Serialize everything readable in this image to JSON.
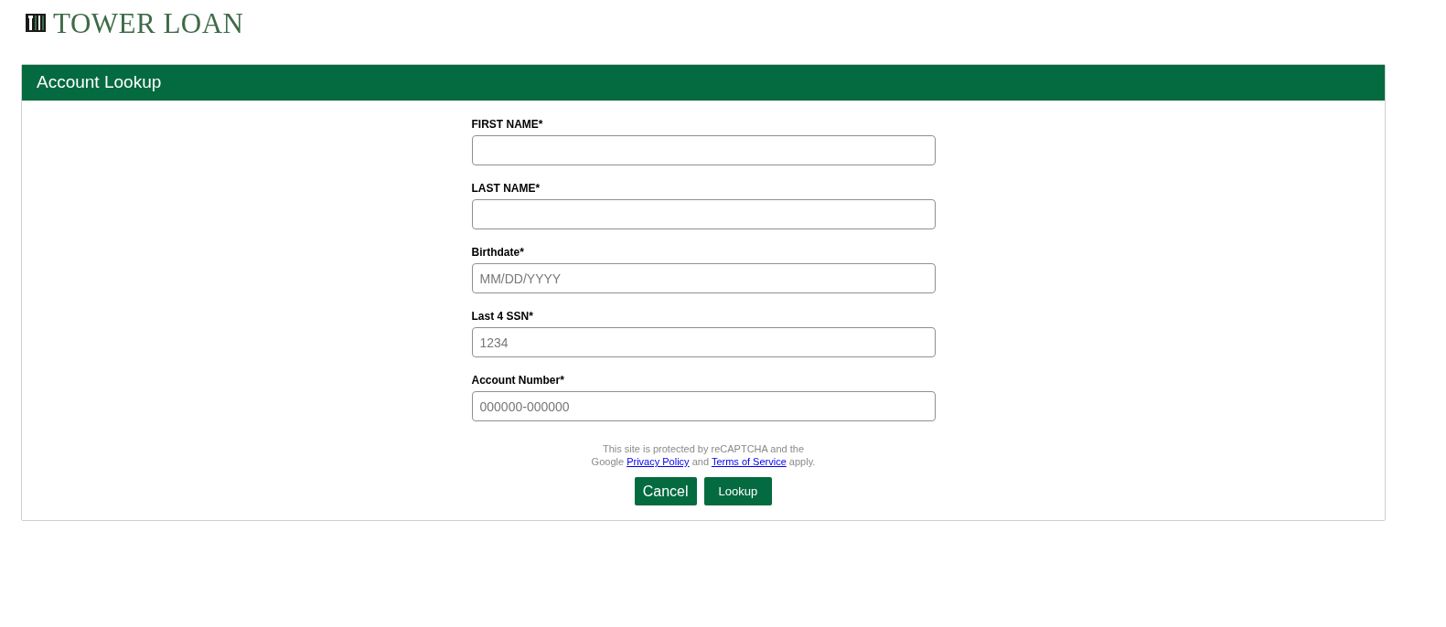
{
  "logo": {
    "text": "TOWER LOAN"
  },
  "panel": {
    "title": "Account Lookup"
  },
  "fields": [
    {
      "label": "FIRST NAME*"
    },
    {
      "label": "LAST NAME*"
    },
    {
      "label": "Birthdate*",
      "placeholder": "MM/DD/YYYY"
    },
    {
      "label": "Last 4 SSN*",
      "placeholder": "1234"
    },
    {
      "label": "Account Number*",
      "placeholder": "000000-000000"
    }
  ],
  "notice": [
    {
      "kind": "text",
      "text": "This site is protected by reCAPTCHA and the"
    },
    {
      "kind": "break"
    },
    {
      "kind": "text",
      "text": "Google "
    },
    {
      "kind": "link",
      "text": "Privacy Policy"
    },
    {
      "kind": "text",
      "text": " and "
    },
    {
      "kind": "link",
      "text": "Terms of Service"
    },
    {
      "kind": "text",
      "text": " apply."
    }
  ],
  "buttons": [
    {
      "label": "Cancel",
      "kind": "cancel"
    },
    {
      "label": "Lookup",
      "kind": "submit"
    }
  ]
}
